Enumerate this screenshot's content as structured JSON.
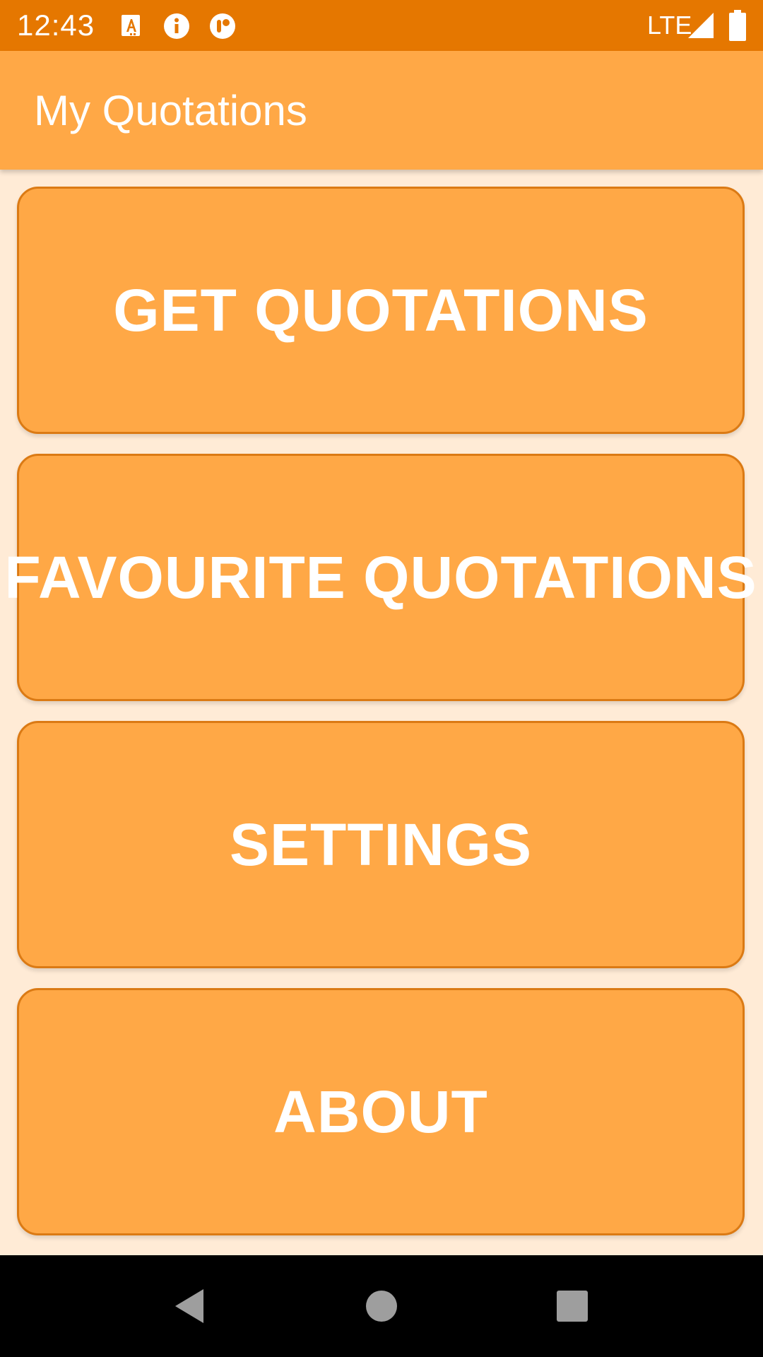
{
  "status_bar": {
    "time": "12:43",
    "network": "LTE",
    "icons": [
      "font-download-icon",
      "info-icon",
      "app-notification-icon",
      "signal-icon",
      "battery-icon"
    ]
  },
  "app_bar": {
    "title": "My Quotations"
  },
  "menu": {
    "buttons": [
      {
        "label": "GET QUOTATIONS"
      },
      {
        "label": "FAVOURITE QUOTATIONS"
      },
      {
        "label": "SETTINGS"
      },
      {
        "label": "ABOUT"
      }
    ]
  },
  "nav_bar": {
    "icons": [
      "back-icon",
      "home-icon",
      "recents-icon"
    ]
  },
  "colors": {
    "status_bar": "#E57700",
    "app_bar": "#FFA846",
    "background": "#FFEBD6",
    "button_fill": "#FFA846",
    "button_border": "#DB7A14",
    "nav_bar": "#000000"
  }
}
